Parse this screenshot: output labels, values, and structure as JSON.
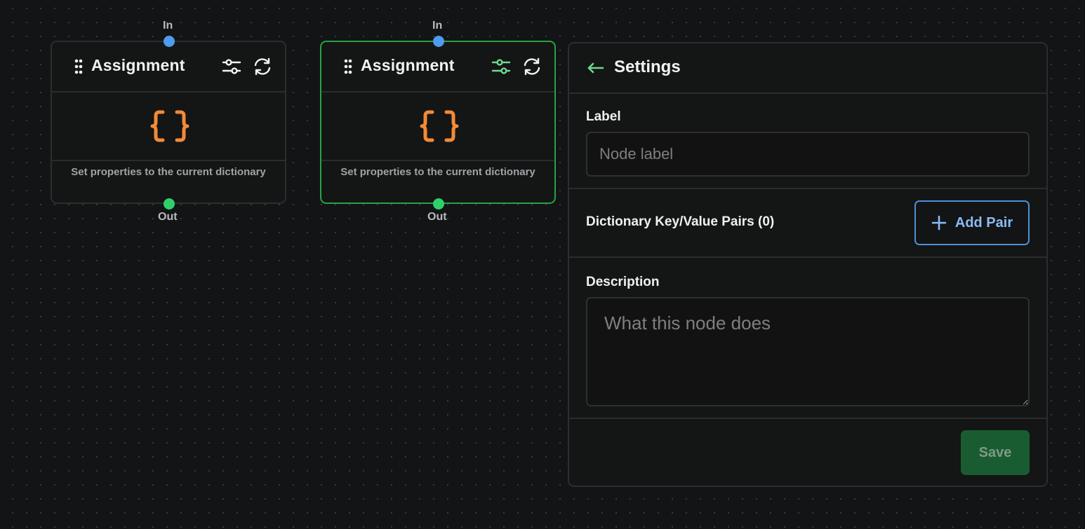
{
  "nodes": [
    {
      "title": "Assignment",
      "description": "Set properties to the current dictionary",
      "in_label": "In",
      "out_label": "Out",
      "selected": false
    },
    {
      "title": "Assignment",
      "description": "Set properties to the current dictionary",
      "in_label": "In",
      "out_label": "Out",
      "selected": true
    }
  ],
  "settings_panel": {
    "title": "Settings",
    "label_field": {
      "label": "Label",
      "placeholder": "Node label",
      "value": ""
    },
    "pairs_section": {
      "label": "Dictionary Key/Value Pairs (0)",
      "add_button": "Add Pair"
    },
    "description_field": {
      "label": "Description",
      "placeholder": "What this node does",
      "value": ""
    },
    "save_button": "Save"
  },
  "colors": {
    "canvas_bg": "#131416",
    "node_bg": "#141515",
    "selected_border": "#27a344",
    "in_port": "#4e9bef",
    "out_port": "#2fd06a",
    "braces_icon": "#f28a37",
    "active_icon": "#6fd990",
    "add_pair_accent": "#8bbcf5",
    "save_bg": "#1a5c31"
  },
  "icons": [
    "drag-handle-icon",
    "sliders-icon",
    "refresh-icon",
    "curly-braces-icon",
    "arrow-left-icon",
    "plus-icon"
  ]
}
